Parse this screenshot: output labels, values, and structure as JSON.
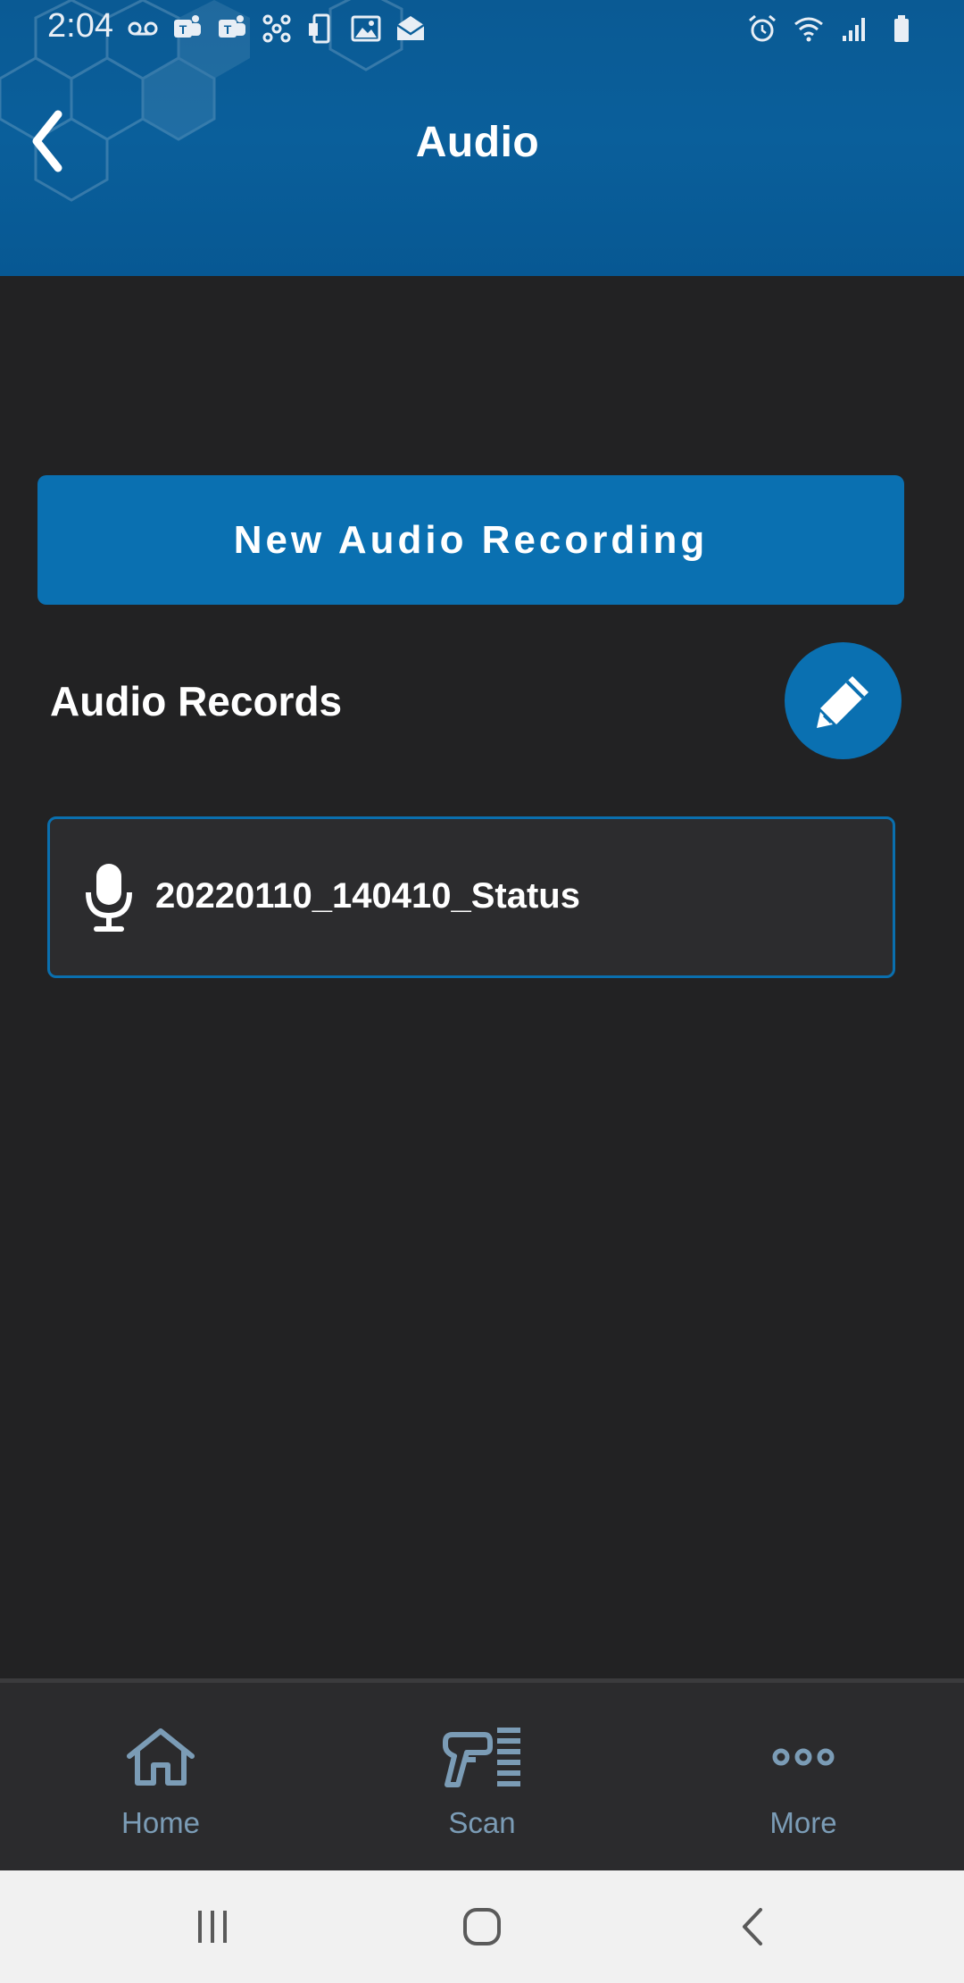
{
  "status_bar": {
    "time": "2:04",
    "left_icons": [
      "voicemail-icon",
      "teams-icon",
      "teams-icon",
      "hub-icon",
      "phone-device-icon",
      "image-icon",
      "email-icon"
    ],
    "right_icons": [
      "alarm-icon",
      "wifi-icon",
      "signal-icon",
      "battery-icon"
    ]
  },
  "header": {
    "title": "Audio",
    "back_icon": "chevron-left-icon"
  },
  "main": {
    "new_recording_label": "New Audio Recording",
    "section_title": "Audio Records",
    "edit_icon": "pencil-icon",
    "records": [
      {
        "icon": "microphone-icon",
        "name": "20220110_140410_Status"
      }
    ]
  },
  "bottom_nav": {
    "items": [
      {
        "label": "Home",
        "icon": "home-icon"
      },
      {
        "label": "Scan",
        "icon": "scanner-icon"
      },
      {
        "label": "More",
        "icon": "more-dots-icon"
      }
    ]
  },
  "system_nav": {
    "buttons": [
      "recent-apps-icon",
      "home-circle-icon",
      "back-icon"
    ]
  },
  "colors": {
    "header_blue": "#0a5f9b",
    "accent_blue": "#0a70b1",
    "background": "#222223",
    "nav_label": "#7b9cb6"
  }
}
